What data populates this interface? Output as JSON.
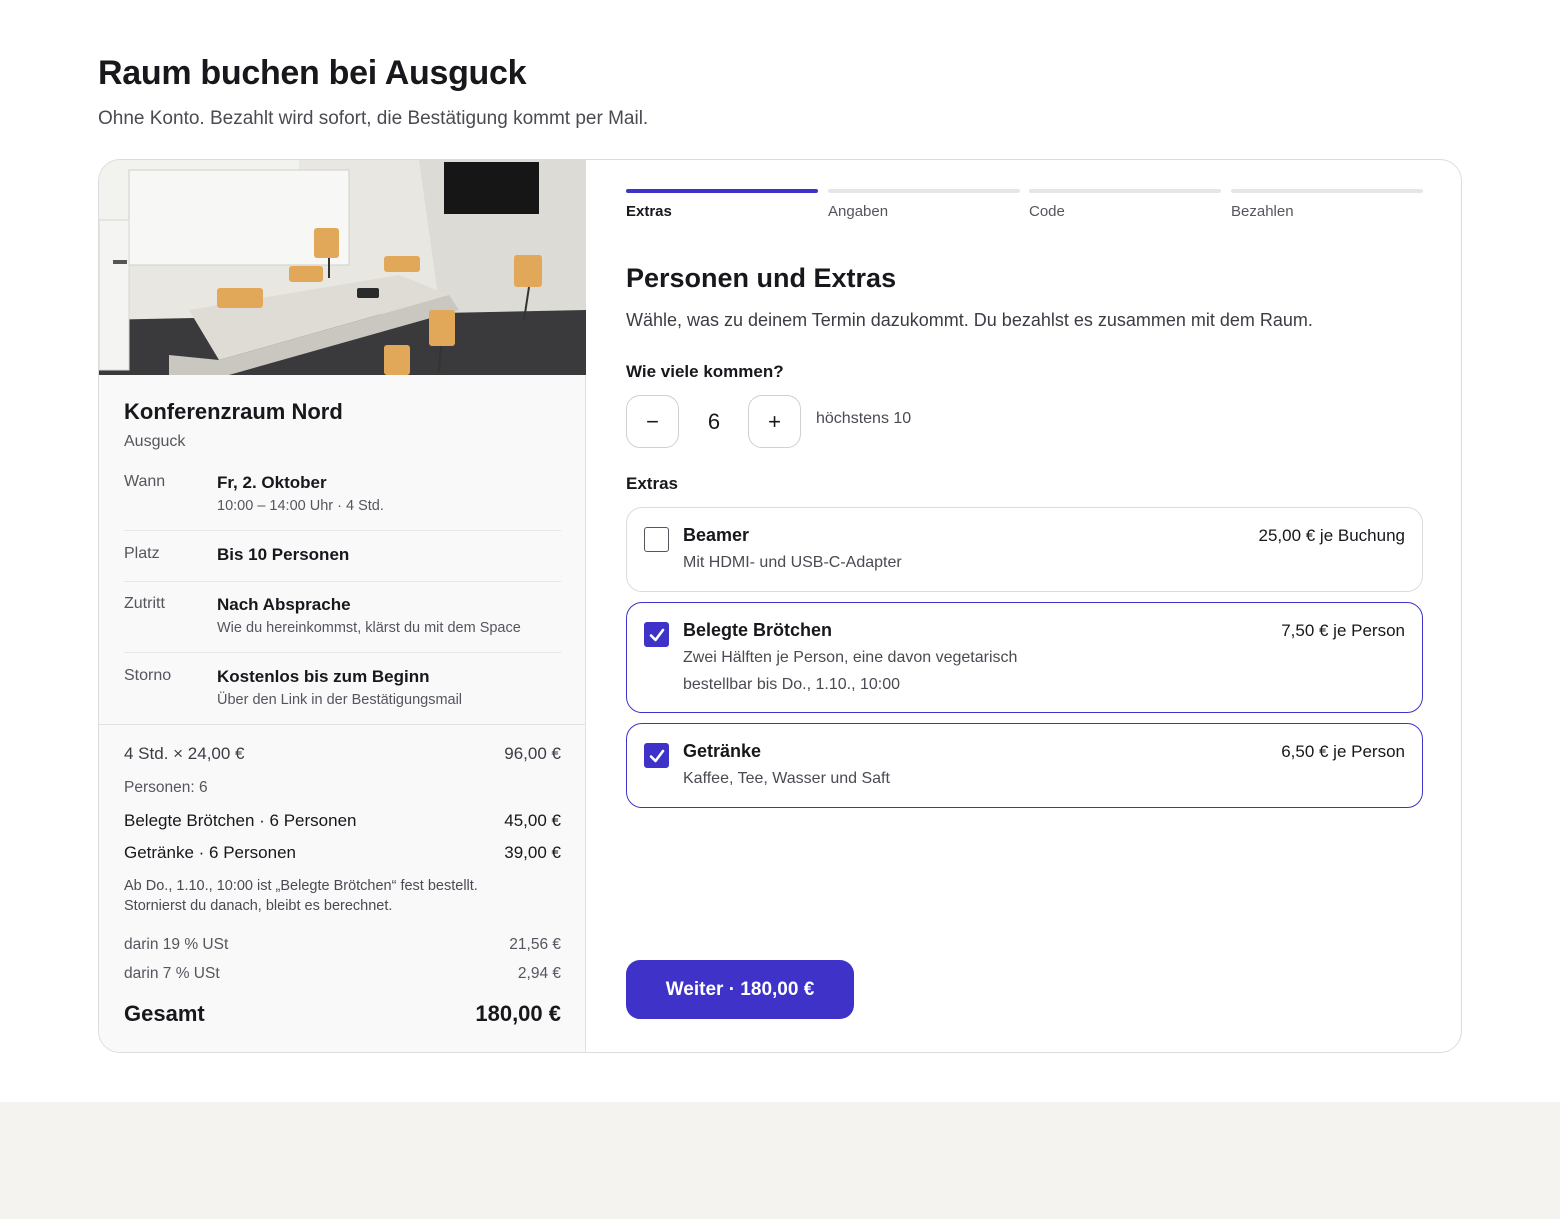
{
  "page": {
    "title": "Raum buchen bei Ausguck",
    "subtitle": "Ohne Konto. Bezahlt wird sofort, die Bestätigung kommt per Mail."
  },
  "room": {
    "name": "Konferenzraum Nord",
    "venue": "Ausguck",
    "details": [
      {
        "label": "Wann",
        "main": "Fr, 2. Oktober",
        "sub": "10:00 – 14:00 Uhr · 4 Std."
      },
      {
        "label": "Platz",
        "main": "Bis 10 Personen",
        "sub": ""
      },
      {
        "label": "Zutritt",
        "main": "Nach Absprache",
        "sub": "Wie du hereinkommst, klärst du mit dem Space"
      },
      {
        "label": "Storno",
        "main": "Kostenlos bis zum Beginn",
        "sub": "Über den Link in der Bestätigungsmail"
      }
    ]
  },
  "summary": {
    "base_label": "4 Std. × 24,00 €",
    "base_value": "96,00 €",
    "persons_label": "Personen: 6",
    "items": [
      {
        "label": "Belegte Brötchen · 6 Personen",
        "value": "45,00 €"
      },
      {
        "label": "Getränke · 6 Personen",
        "value": "39,00 €"
      }
    ],
    "note_line1": "Ab Do., 1.10., 10:00 ist „Belegte Brötchen“ fest bestellt.",
    "note_line2": "Stornierst du danach, bleibt es berechnet.",
    "tax": [
      {
        "label": "darin 19 % USt",
        "value": "21,56 €"
      },
      {
        "label": "darin 7 % USt",
        "value": "2,94 €"
      }
    ],
    "total_label": "Gesamt",
    "total_value": "180,00 €"
  },
  "steps": [
    {
      "label": "Extras",
      "active": true
    },
    {
      "label": "Angaben",
      "active": false
    },
    {
      "label": "Code",
      "active": false
    },
    {
      "label": "Bezahlen",
      "active": false
    }
  ],
  "form": {
    "title": "Personen und Extras",
    "description": "Wähle, was zu deinem Termin dazukommt. Du bezahlst es zusammen mit dem Raum.",
    "persons_question": "Wie viele kommen?",
    "decrement_symbol": "−",
    "increment_symbol": "+",
    "persons_value": "6",
    "persons_hint": "höchstens 10",
    "extras_label": "Extras",
    "extras": [
      {
        "name": "Beamer",
        "price": "25,00 € je Buchung",
        "desc": "Mit HDMI- und USB-C-Adapter",
        "desc2": "",
        "checked": false
      },
      {
        "name": "Belegte Brötchen",
        "price": "7,50 € je Person",
        "desc": "Zwei Hälften je Person, eine davon vegetarisch",
        "desc2": "bestellbar bis Do., 1.10., 10:00",
        "checked": true
      },
      {
        "name": "Getränke",
        "price": "6,50 € je Person",
        "desc": "Kaffee, Tee, Wasser und Saft",
        "desc2": "",
        "checked": true
      }
    ],
    "cta_label": "Weiter · 180,00 €"
  },
  "colors": {
    "accent": "#3e32c9",
    "border": "#dcdcdf",
    "footer_band": "#f4f3f0"
  }
}
